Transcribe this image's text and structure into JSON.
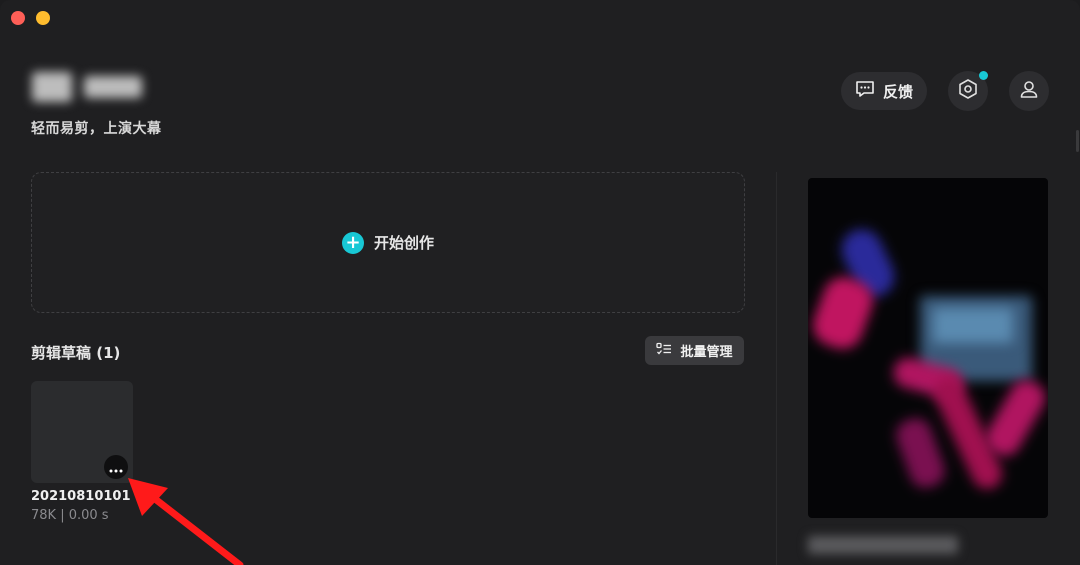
{
  "window": {
    "controls": [
      "close",
      "minimize"
    ]
  },
  "header": {
    "logo_icon": "app-logo-blurred",
    "slogan": "轻而易剪，上演大幕",
    "feedback_label": "反馈",
    "feedback_icon": "chat-bubble-icon",
    "settings_icon": "hexagon-gear-icon",
    "user_icon": "user-icon",
    "notify_color": "#18c8d5"
  },
  "create": {
    "label": "开始创作",
    "icon": "plus-circle-icon",
    "accent": "#18c8d5"
  },
  "drafts": {
    "title": "剪辑草稿 (1)",
    "batch_label": "批量管理",
    "batch_icon": "list-manage-icon",
    "items": [
      {
        "name": "20210810101",
        "meta": "78K | 0.00 s",
        "more_icon": "ellipsis-icon"
      }
    ]
  },
  "annotation": {
    "arrow_color": "#ff1a1a"
  }
}
